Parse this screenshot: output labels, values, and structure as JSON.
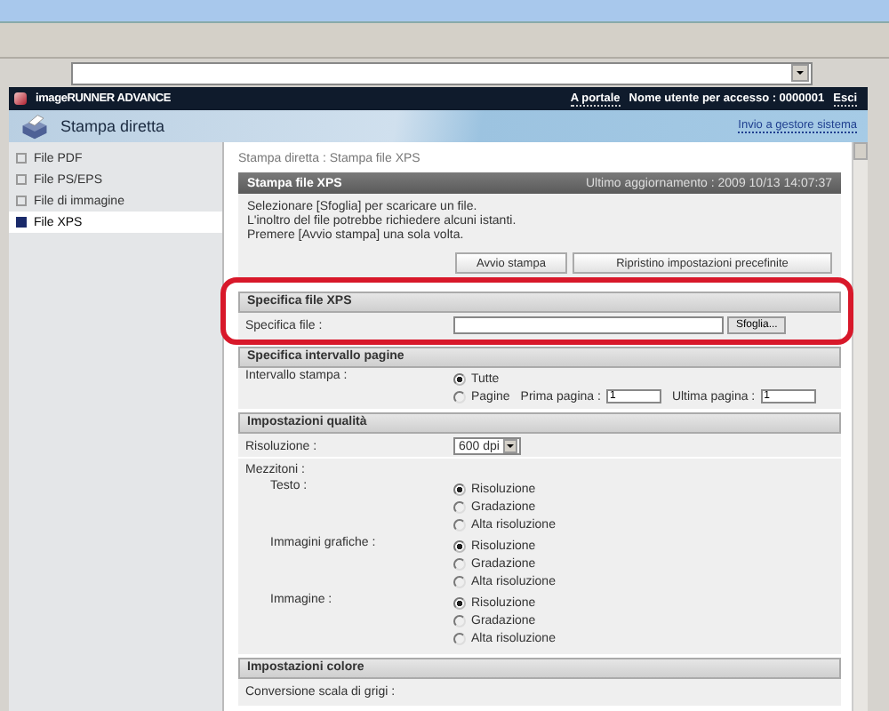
{
  "header": {
    "brand": "imageRUNNER ADVANCE",
    "portal_link": "A portale",
    "user_label": "Nome utente per accesso : 0000001",
    "logout_link": "Esci"
  },
  "title_bar": {
    "title": "Stampa diretta",
    "link": "Invio a gestore sistema"
  },
  "sidebar": {
    "items": [
      {
        "label": "File PDF",
        "selected": false
      },
      {
        "label": "File PS/EPS",
        "selected": false
      },
      {
        "label": "File di immagine",
        "selected": false
      },
      {
        "label": "File XPS",
        "selected": true
      }
    ]
  },
  "breadcrumb": "Stampa diretta : Stampa file XPS",
  "panel": {
    "title": "Stampa file XPS",
    "updated": "Ultimo aggiornamento : 2009 10/13 14:07:37",
    "messages": [
      "Selezionare [Sfoglia] per scaricare un file.",
      "L'inoltro del file potrebbe richiedere alcuni istanti.",
      "Premere [Avvio stampa] una sola volta."
    ],
    "buttons": [
      "Avvio stampa",
      "Ripristino impostazioni precefinite"
    ]
  },
  "file_section": {
    "title": "Specifica file XPS",
    "highlighted": true,
    "label": "Specifica file :",
    "browse_button": "Sfoglia..."
  },
  "range_section": {
    "title": "Specifica intervallo pagine",
    "label": "Intervallo stampa :",
    "options": [
      {
        "label": "Tutte",
        "selected": true
      },
      {
        "label": "Pagine",
        "selected": false
      }
    ],
    "first_page": {
      "label": "Prima pagina :",
      "value": "1"
    },
    "last_page": {
      "label": "Ultima pagina :",
      "value": "1"
    }
  },
  "quality_section": {
    "title": "Impostazioni qualità",
    "resolution": {
      "label": "Risoluzione :",
      "value": "600 dpi"
    },
    "halftone_label": "Mezzitoni :",
    "groups": [
      {
        "label": "Testo :",
        "options": [
          {
            "label": "Risoluzione",
            "selected": true
          },
          {
            "label": "Gradazione",
            "selected": false
          },
          {
            "label": "Alta risoluzione",
            "selected": false
          }
        ]
      },
      {
        "label": "Immagini grafiche :",
        "options": [
          {
            "label": "Risoluzione",
            "selected": true
          },
          {
            "label": "Gradazione",
            "selected": false
          },
          {
            "label": "Alta risoluzione",
            "selected": false
          }
        ]
      },
      {
        "label": "Immagine :",
        "options": [
          {
            "label": "Risoluzione",
            "selected": true
          },
          {
            "label": "Gradazione",
            "selected": false
          },
          {
            "label": "Alta risoluzione",
            "selected": false
          }
        ]
      }
    ]
  },
  "color_section": {
    "title": "Impostazioni colore",
    "rows": [
      "Conversione scala di grigi :"
    ]
  }
}
